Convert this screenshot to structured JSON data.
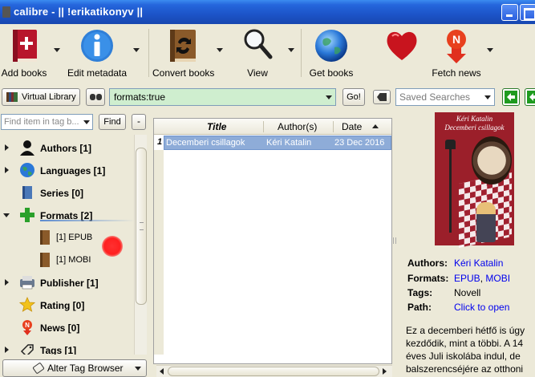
{
  "window": {
    "title": "calibre - || !erikatikonyv ||"
  },
  "toolbar": {
    "add_books": "Add books",
    "edit_metadata": "Edit metadata",
    "convert_books": "Convert books",
    "view": "View",
    "get_books": "Get books",
    "fetch_news": "Fetch news"
  },
  "search": {
    "virtual_library": "Virtual Library",
    "query": "formats:true",
    "go": "Go!",
    "saved_searches_placeholder": "Saved Searches"
  },
  "tag_browser": {
    "find_placeholder": "Find item in tag b...",
    "find_button": "Find",
    "collapse_button": "-",
    "items": [
      {
        "label": "Authors [1]",
        "icon": "person-icon",
        "expanded": false
      },
      {
        "label": "Languages [1]",
        "icon": "globe-icon",
        "expanded": false
      },
      {
        "label": "Series [0]",
        "icon": "series-icon",
        "expanded": false
      },
      {
        "label": "Formats [2]",
        "icon": "plus-icon",
        "expanded": true
      },
      {
        "label": "[1] EPUB",
        "icon": "book-icon",
        "child": true
      },
      {
        "label": "[1] MOBI",
        "icon": "book-icon",
        "child": true
      },
      {
        "label": "Publisher [1]",
        "icon": "publisher-icon",
        "expanded": false
      },
      {
        "label": "Rating [0]",
        "icon": "star-icon",
        "expanded": false
      },
      {
        "label": "News [0]",
        "icon": "news-icon",
        "expanded": false
      },
      {
        "label": "Tags [1]",
        "icon": "tag-icon",
        "expanded": false
      }
    ],
    "alter_button": "Alter Tag Browser"
  },
  "book_list": {
    "columns": [
      "Title",
      "Author(s)",
      "Date"
    ],
    "rows": [
      {
        "num": "1",
        "title": "Decemberi csillagok",
        "author": "Kéri Katalin",
        "date": "23 Dec 2016"
      }
    ]
  },
  "cover": {
    "author": "Kéri Katalin",
    "title": "Decemberi csillagok"
  },
  "details": {
    "authors_label": "Authors:",
    "authors_value": "Kéri Katalin",
    "formats_label": "Formats:",
    "format_epub": "EPUB",
    "format_sep": ", ",
    "format_mobi": "MOBI",
    "tags_label": "Tags:",
    "tags_value": "Novell",
    "path_label": "Path:",
    "path_value": "Click to open",
    "comments": "Ez a decemberi hétfő is úgy kezdődik, mint a többi. A 14 éves Juli iskolába indul, de balszerencséjére az otthoni nyuszifüles papucsban"
  },
  "colors": {
    "titlebar": "#2566dc",
    "selection": "#8eacd8",
    "search_bg": "#cfeecf",
    "link": "#0000ee",
    "cover_bg": "#9b1f2a"
  }
}
